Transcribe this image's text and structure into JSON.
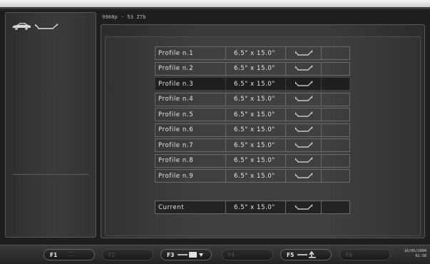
{
  "header": {
    "text": "9960p · 53 Z7b"
  },
  "left_panel": {
    "car_icon": "car-icon",
    "profile_icon": "wheel-profile-icon"
  },
  "profiles": [
    {
      "name": "Profile n.1",
      "size": "6.5\" x 15.0\"",
      "icon": "wheel-profile-icon"
    },
    {
      "name": "Profile n.2",
      "size": "6.5\" x 15.0\"",
      "icon": "wheel-profile-icon"
    },
    {
      "name": "Profile n.3",
      "size": "6.5\" x 15.0\"",
      "icon": "wheel-profile-icon",
      "selected": true
    },
    {
      "name": "Profile n.4",
      "size": "6.5\" x 15.0\"",
      "icon": "wheel-profile-icon"
    },
    {
      "name": "Profile n.5",
      "size": "6.5\" x 15.0\"",
      "icon": "wheel-profile-icon"
    },
    {
      "name": "Profile n.6",
      "size": "6.5\" x 15.0\"",
      "icon": "wheel-profile-icon"
    },
    {
      "name": "Profile n.7",
      "size": "6.5\" x 15.0\"",
      "icon": "wheel-profile-icon"
    },
    {
      "name": "Profile n.8",
      "size": "6.5\" x 15.0\"",
      "icon": "wheel-profile-icon"
    },
    {
      "name": "Profile n.9",
      "size": "6.5\" x 15.0\"",
      "icon": "wheel-profile-icon"
    }
  ],
  "current": {
    "name": "Current",
    "size": "6.5\" x 15.0\"",
    "icon": "wheel-profile-icon"
  },
  "function_keys": {
    "f1": {
      "label": "F1",
      "icon": "dots-icon",
      "enabled": true
    },
    "f2": {
      "label": "F2",
      "enabled": false
    },
    "f3": {
      "label": "F3",
      "icon": "save-profile-icon",
      "enabled": true
    },
    "f4": {
      "label": "F4",
      "enabled": false
    },
    "f5": {
      "label": "F5",
      "icon": "load-profile-icon",
      "enabled": true
    },
    "f6": {
      "label": "F6",
      "enabled": false
    }
  },
  "status": {
    "date": "16/05/2004",
    "time": "02:38"
  },
  "colors": {
    "background": "#1e1e1e",
    "panel": "#3a3a3a",
    "selected_row": "#1f1f1f",
    "text": "#e6e6e6"
  }
}
